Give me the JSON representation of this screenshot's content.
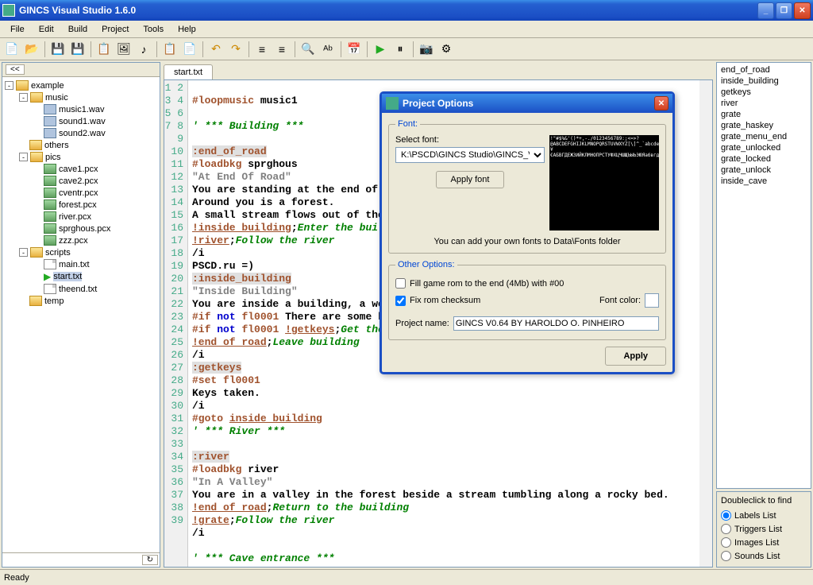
{
  "window": {
    "title": "GINCS Visual Studio 1.6.0"
  },
  "menu": [
    "File",
    "Edit",
    "Build",
    "Project",
    "Tools",
    "Help"
  ],
  "tree": {
    "root": "example",
    "music": {
      "name": "music",
      "items": [
        "music1.wav",
        "sound1.wav",
        "sound2.wav"
      ]
    },
    "others": "others",
    "pics": {
      "name": "pics",
      "items": [
        "cave1.pcx",
        "cave2.pcx",
        "cventr.pcx",
        "forest.pcx",
        "river.pcx",
        "sprghous.pcx",
        "zzz.pcx"
      ]
    },
    "scripts": {
      "name": "scripts",
      "items": [
        "main.txt",
        "start.txt",
        "theend.txt"
      ]
    },
    "temp": "temp"
  },
  "tab": "start.txt",
  "code_lines": [
    "",
    "<span class='c-dir'>#loopmusic</span> <span class='c-txt'>music1</span>",
    "",
    "<span class='c-cmt'>' *** Building ***</span>",
    "",
    "<span class='c-lbl'>:end_of_road</span>",
    "<span class='c-dir'>#loadbkg</span> <span class='c-txt'>sprghous</span>",
    "<span class='c-str'>\"At End Of Road\"</span>",
    "<span class='c-txt'>You are standing at the end of a </span>",
    "<span class='c-txt'>Around you is a forest.</span>",
    "<span class='c-txt'>A small stream flows out of the b</span>",
    "<span class='c-ref'>!inside_building</span><span class='c-txt'>;</span><span class='c-cmt'>Enter the build</span>",
    "<span class='c-ref'>!river</span><span class='c-txt'>;</span><span class='c-cmt'>Follow the river</span>",
    "<span class='c-txt'>/i</span>",
    "<span class='c-txt'>PSCD.ru =)</span>",
    "<span class='c-lbl'>:inside_building</span>",
    "<span class='c-str'>\"Inside Building\"</span>",
    "<span class='c-txt'>You are inside a building, a well</span>",
    "<span class='c-dir'>#if</span> <span class='c-kw'>not</span> <span class='c-dir'>fl0001</span> <span class='c-txt'>There are some key</span>",
    "<span class='c-dir'>#if</span> <span class='c-kw'>not</span> <span class='c-dir'>fl0001</span> <span class='c-ref'>!getkeys</span><span class='c-txt'>;</span><span class='c-cmt'>Get the k</span>",
    "<span class='c-ref'>!end_of_road</span><span class='c-txt'>;</span><span class='c-cmt'>Leave building</span>",
    "<span class='c-txt'>/i</span>",
    "<span class='c-lbl'>:getkeys</span>",
    "<span class='c-dir'>#set</span> <span class='c-dir'>fl0001</span>",
    "<span class='c-txt'>Keys taken.</span>",
    "<span class='c-txt'>/i</span>",
    "<span class='c-dir'>#goto</span> <span class='c-ref'>inside_building</span>",
    "<span class='c-cmt'>' *** River ***</span>",
    "",
    "<span class='c-lbl'>:river</span>",
    "<span class='c-dir'>#loadbkg</span> <span class='c-txt'>river</span>",
    "<span class='c-str'>\"In A Valley\"</span>",
    "<span class='c-txt'>You are in a valley in the forest beside a stream tumbling along a rocky bed.</span>",
    "<span class='c-ref'>!end_of_road</span><span class='c-txt'>;</span><span class='c-cmt'>Return to the building</span>",
    "<span class='c-ref'>!grate</span><span class='c-txt'>;</span><span class='c-cmt'>Follow the river</span>",
    "<span class='c-txt'>/i</span>",
    "",
    "<span class='c-cmt'>' *** Cave entrance ***</span>",
    ""
  ],
  "labels": [
    "end_of_road",
    "inside_building",
    "getkeys",
    "river",
    "grate",
    "grate_haskey",
    "grate_menu_end",
    "grate_unlocked",
    "grate_locked",
    "grate_unlock",
    "inside_cave"
  ],
  "radio": {
    "title": "Doubleclick to find",
    "opts": [
      "Labels List",
      "Triggers List",
      "Images List",
      "Sounds List"
    ]
  },
  "dialog": {
    "title": "Project Options",
    "font_group": "Font:",
    "select_font": "Select font:",
    "font_path": "K:\\PSCD\\GINCS Studio\\GINCS_V",
    "apply_font": "Apply font",
    "font_note": "You can add your own fonts to Data\\Fonts folder",
    "other_group": "Other Options:",
    "fill_rom": "Fill game rom to the end (4Mb) with #00",
    "fix_checksum": "Fix rom checksum",
    "font_color": "Font color:",
    "project_name_lbl": "Project name:",
    "project_name": "GINCS V0.64 BY HAROLDO O. PINHEIRO",
    "apply": "Apply"
  },
  "status": "Ready"
}
